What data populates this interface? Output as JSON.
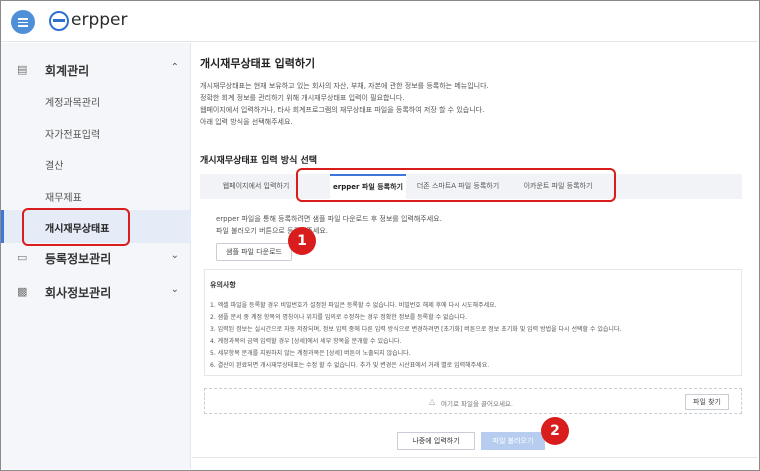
{
  "app": {
    "logo": "erpper"
  },
  "colors": {
    "accent": "#3c76d8",
    "highlight": "#d91c1c"
  },
  "sidebar": {
    "groups": [
      {
        "label": "회계관리",
        "icon": "chart-icon",
        "expanded": true
      },
      {
        "label": "등록정보관리",
        "icon": "monitor-icon",
        "expanded": false
      },
      {
        "label": "회사정보관리",
        "icon": "building-icon",
        "expanded": false
      }
    ],
    "sub_items": [
      "계정과목관리",
      "자가전표입력",
      "결산",
      "재무제표",
      "개시재무상태표"
    ],
    "active": "개시재무상태표"
  },
  "main": {
    "title": "개시재무상태표 입력하기",
    "description": [
      "개시재무상태표는 현재 보유하고 있는 회사의 자산, 부채, 자본에 관한 정보를 등록하는 메뉴입니다.",
      "정확한 회계 정보를 관리하기 위해 개시재무상태표 입력이 필요합니다.",
      "웹페이지에서 입력하거나, 타사 회계프로그램의 재무상태표 파일을 등록하여 저장 할 수 있습니다.",
      "아래 입력 방식을 선택해주세요."
    ],
    "section_title": "개시재무상태표 입력 방식 선택",
    "tabs": [
      "웹페이지에서 입력하기",
      "erpper 파일 등록하기",
      "더존 스마트A 파일 등록하기",
      "이카운트 파일 등록하기"
    ],
    "active_tab": "erpper 파일 등록하기",
    "hints": [
      "erpper 파일을 통해 등록하려면 샘플 파일 다운로드 후 정보를 입력해주세요.",
      "파일 불러오기 버튼으로 등록해주세요."
    ],
    "sample_button": "샘플 파일 다운로드",
    "notice": {
      "title": "유의사항",
      "items": [
        "1. 엑셀 파일을 등록할 경우 비밀번호가 설정된 파일은 등록할 수 없습니다. 비밀번호 해제 후에 다시 시도해주세요.",
        "2. 샘플 문서 중 계정 항목의 명칭이나 위치를 임의로 수정하는 경우 정확한 정보를 등록할 수 없습니다.",
        "3. 입력된 정보는 실시간으로 자동 저장되며, 정보 입력 중에 다른 입력 방식으로 변경하려면 [초기화] 버튼으로 정보 초기화 및 입력 방법을 다시 선택할 수 있습니다.",
        "4. 계정과목의 금액 입력할 경우 [상세]에서 세부 항목을 분개할 수 있습니다.",
        "5. 세부항목 분개를 지원하지 않는 계정과목은 [상세] 버튼이 노출되지 않습니다.",
        "6. 결산이 완료되면 개시재무상태표는 수정 할 수 없습니다. 추가 및 변경은 시산표에서 거래 별로 입력해주세요."
      ]
    },
    "dropzone": {
      "text": "여기로 파일을 끌어오세요.",
      "find_button": "파일 찾기"
    },
    "later_button": "나중에 입력하기",
    "load_button": "파일 불러오기"
  },
  "annotations": {
    "badge1": "1",
    "badge2": "2"
  }
}
